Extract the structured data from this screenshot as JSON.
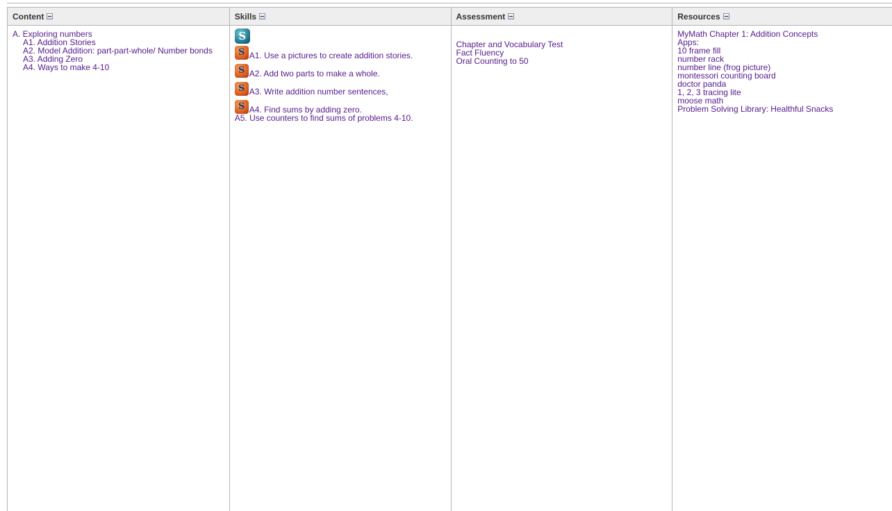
{
  "columns": {
    "content": {
      "header": "Content",
      "items": [
        {
          "text": "A. Exploring numbers",
          "indent": false
        },
        {
          "text": "A1. Addition Stories",
          "indent": true
        },
        {
          "text": "A2. Model Addition: part-part-whole/ Number bonds",
          "indent": true
        },
        {
          "text": "A3. Adding Zero",
          "indent": true
        },
        {
          "text": "A4. Ways to make 4-10",
          "indent": true
        }
      ]
    },
    "skills": {
      "header": "Skills",
      "logo_icon": "standards-check-icon",
      "items": [
        {
          "icon": "skill-standard-icon",
          "text": "A1. Use a pictures to create addition stories."
        },
        {
          "icon": "skill-standard-icon",
          "text": "A2. Add two parts to make a whole."
        },
        {
          "icon": "skill-standard-icon",
          "text": "A3. Write addition number sentences,"
        },
        {
          "icon": "skill-standard-icon",
          "text": "A4. Find sums by adding zero."
        }
      ],
      "plain_item": "A5. Use counters to find sums of problems 4-10."
    },
    "assessment": {
      "header": "Assessment",
      "items": [
        "Chapter and Vocabulary Test",
        "Fact Fluency",
        "Oral Counting to 50"
      ]
    },
    "resources": {
      "header": "Resources",
      "items": [
        "MyMath Chapter 1: Addition Concepts",
        "Apps:",
        "10 frame fill",
        "number rack",
        "number line (frog picture)",
        "montessori counting board",
        "doctor panda",
        "1, 2, 3 tracing lite",
        "moose math",
        "Problem Solving Library: Healthful Snacks"
      ]
    }
  },
  "colors": {
    "link": "#551a8b",
    "header_bg": "#eeeeee",
    "border": "#b5b5b5"
  }
}
